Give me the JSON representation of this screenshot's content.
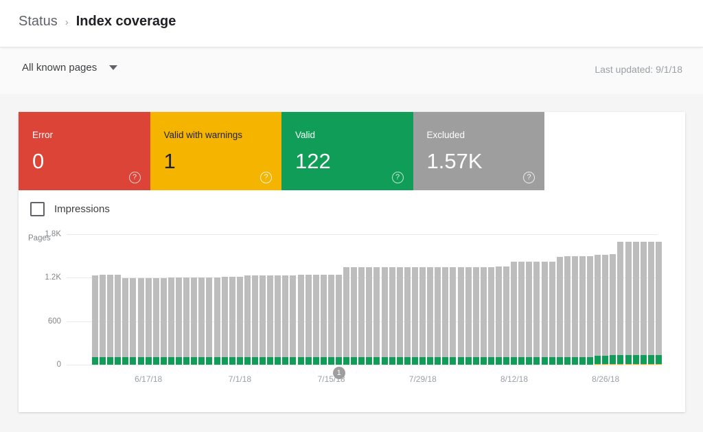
{
  "header": {
    "breadcrumb_parent": "Status",
    "breadcrumb_separator": "›",
    "breadcrumb_current": "Index coverage"
  },
  "toolbar": {
    "filter_label": "All known pages",
    "filter_caret_icon": "chevron-down-icon",
    "last_updated": "Last updated: 9/1/18"
  },
  "cards": [
    {
      "label": "Error",
      "value": "0",
      "color": "#db4437",
      "help_icon": "help-icon"
    },
    {
      "label": "Valid with warnings",
      "value": "1",
      "color": "#f4b400",
      "help_icon": "help-icon"
    },
    {
      "label": "Valid",
      "value": "122",
      "color": "#0f9d58",
      "help_icon": "help-icon"
    },
    {
      "label": "Excluded",
      "value": "1.57K",
      "color": "#9e9e9e",
      "help_icon": "help-icon"
    }
  ],
  "legend": {
    "impressions_label": "Impressions",
    "impressions_checked": false
  },
  "chart_data": {
    "type": "bar",
    "stacked": true,
    "title": "",
    "xlabel": "",
    "ylabel": "Pages",
    "ylim": [
      0,
      1800
    ],
    "yticks": [
      1800,
      1200,
      600,
      0
    ],
    "ytick_labels": [
      "1.8K",
      "1.2K",
      "600",
      "0"
    ],
    "grid": true,
    "legend_position": "top-left",
    "xtick_labels": [
      "6/17/18",
      "7/1/18",
      "7/15/18",
      "7/29/18",
      "8/12/18",
      "8/26/18"
    ],
    "xtick_indices": [
      7,
      19,
      31,
      43,
      55,
      67
    ],
    "colors": {
      "valid": "#0f9d58",
      "valid_with_warnings": "#f4b400",
      "excluded": "#bdbdbd"
    },
    "series": [
      {
        "name": "Valid",
        "color": "#0f9d58",
        "values": [
          100,
          100,
          100,
          100,
          100,
          100,
          100,
          100,
          100,
          100,
          100,
          100,
          100,
          100,
          100,
          100,
          100,
          100,
          100,
          100,
          100,
          100,
          100,
          100,
          100,
          100,
          100,
          100,
          100,
          100,
          100,
          100,
          100,
          100,
          100,
          100,
          100,
          100,
          100,
          100,
          100,
          100,
          100,
          100,
          100,
          100,
          100,
          100,
          100,
          100,
          100,
          100,
          100,
          100,
          100,
          100,
          100,
          100,
          100,
          100,
          100,
          100,
          100,
          100,
          100,
          105,
          110,
          115,
          120,
          122,
          122,
          122,
          122,
          122,
          122
        ]
      },
      {
        "name": "Valid with warnings",
        "color": "#f4b400",
        "values": [
          0,
          0,
          0,
          0,
          0,
          0,
          0,
          0,
          0,
          0,
          0,
          0,
          0,
          0,
          0,
          0,
          0,
          0,
          0,
          0,
          0,
          0,
          0,
          0,
          0,
          0,
          0,
          0,
          0,
          0,
          0,
          0,
          0,
          0,
          0,
          0,
          0,
          0,
          0,
          0,
          0,
          0,
          0,
          0,
          0,
          0,
          0,
          0,
          0,
          0,
          0,
          0,
          0,
          0,
          0,
          0,
          0,
          0,
          0,
          0,
          0,
          0,
          0,
          0,
          0,
          0,
          1,
          1,
          1,
          1,
          1,
          1,
          1,
          1,
          1
        ]
      },
      {
        "name": "Excluded",
        "color": "#bdbdbd",
        "values": [
          1130,
          1140,
          1140,
          1140,
          1090,
          1090,
          1090,
          1090,
          1090,
          1090,
          1100,
          1105,
          1105,
          1105,
          1105,
          1105,
          1105,
          1110,
          1110,
          1110,
          1130,
          1130,
          1130,
          1130,
          1135,
          1135,
          1135,
          1140,
          1140,
          1140,
          1140,
          1140,
          1145,
          1250,
          1250,
          1250,
          1250,
          1250,
          1250,
          1250,
          1250,
          1250,
          1250,
          1250,
          1250,
          1250,
          1250,
          1250,
          1250,
          1250,
          1250,
          1250,
          1250,
          1255,
          1255,
          1320,
          1325,
          1325,
          1325,
          1325,
          1325,
          1390,
          1395,
          1395,
          1395,
          1395,
          1395,
          1395,
          1400,
          1560,
          1560,
          1565,
          1565,
          1565,
          1565
        ]
      }
    ],
    "totals": [
      1230,
      1240,
      1240,
      1240,
      1190,
      1190,
      1190,
      1190,
      1190,
      1190,
      1200,
      1205,
      1205,
      1205,
      1205,
      1205,
      1205,
      1210,
      1210,
      1210,
      1230,
      1230,
      1230,
      1230,
      1235,
      1235,
      1235,
      1240,
      1240,
      1240,
      1240,
      1240,
      1245,
      1350,
      1350,
      1350,
      1350,
      1350,
      1350,
      1350,
      1350,
      1350,
      1350,
      1350,
      1350,
      1350,
      1350,
      1350,
      1350,
      1350,
      1350,
      1350,
      1350,
      1355,
      1355,
      1420,
      1425,
      1425,
      1425,
      1425,
      1425,
      1490,
      1495,
      1500,
      1505,
      1510,
      1520,
      1530,
      1540,
      1690,
      1690,
      1695,
      1695,
      1695,
      1695
    ],
    "annotations": [
      {
        "label": "1",
        "index": 32,
        "icon": "annotation-badge"
      }
    ]
  }
}
